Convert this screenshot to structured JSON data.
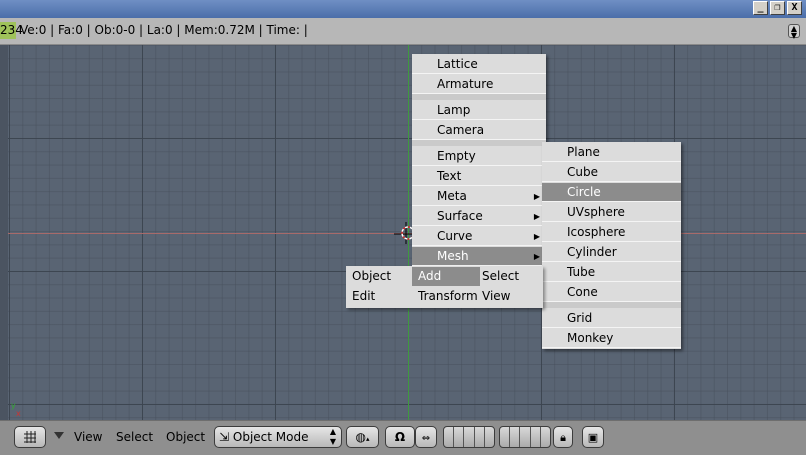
{
  "window": {
    "minimize": "_",
    "restore": "❐",
    "close": "X"
  },
  "info": {
    "num": "234",
    "text": "Ve:0 | Fa:0 | Ob:0-0 | La:0 | Mem:0.72M | Time: |"
  },
  "viewport": {
    "axes_label_y": "y",
    "axes_label_x": "x"
  },
  "menu_add": {
    "items": [
      {
        "label": "Lattice"
      },
      {
        "label": "Armature"
      },
      {
        "label": "Lamp"
      },
      {
        "label": "Camera"
      },
      {
        "label": "Empty"
      },
      {
        "label": "Text"
      },
      {
        "label": "Meta",
        "arrow": "▶"
      },
      {
        "label": "Surface",
        "arrow": "▶"
      },
      {
        "label": "Curve",
        "arrow": "▶"
      },
      {
        "label": "Mesh",
        "arrow": "▶",
        "highlighted": true
      }
    ]
  },
  "menu_mesh": {
    "items": [
      {
        "label": "Plane"
      },
      {
        "label": "Cube"
      },
      {
        "label": "Circle",
        "highlighted": true
      },
      {
        "label": "UVsphere"
      },
      {
        "label": "Icosphere"
      },
      {
        "label": "Cylinder"
      },
      {
        "label": "Tube"
      },
      {
        "label": "Cone"
      },
      {
        "label": "Grid"
      },
      {
        "label": "Monkey"
      }
    ]
  },
  "toolbox": {
    "row1": [
      "Object",
      "Add",
      "Select"
    ],
    "row2": [
      "Edit",
      "Transform",
      "View"
    ],
    "active": "Add"
  },
  "header": {
    "view": "View",
    "select": "Select",
    "object": "Object",
    "mode": "Object Mode"
  },
  "colors": {
    "highlight": "#8c8c8c",
    "menu_bg": "#dcdcdc",
    "viewport_bg": "#596473"
  }
}
